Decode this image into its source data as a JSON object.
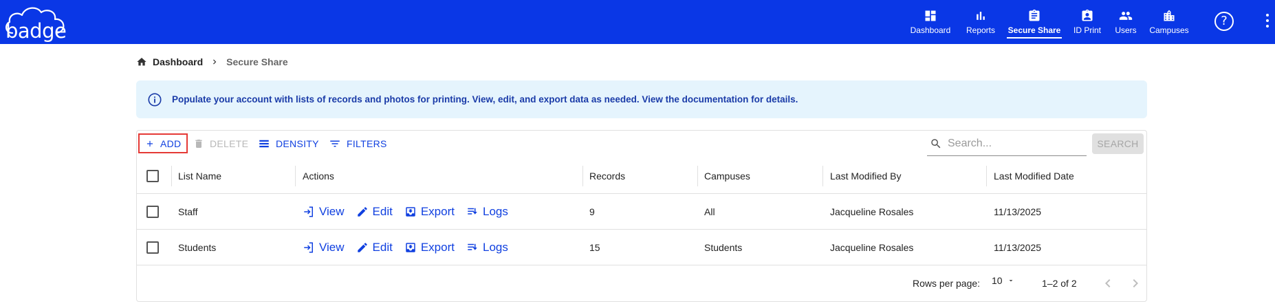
{
  "app": {
    "logo_text": "badge"
  },
  "nav": {
    "items": [
      {
        "label": "Dashboard",
        "icon": "dashboard-icon",
        "active": false
      },
      {
        "label": "Reports",
        "icon": "bar-chart-icon",
        "active": false
      },
      {
        "label": "Secure Share",
        "icon": "clipboard-icon",
        "active": true
      },
      {
        "label": "ID Print",
        "icon": "id-badge-icon",
        "active": false
      },
      {
        "label": "Users",
        "icon": "users-icon",
        "active": false
      },
      {
        "label": "Campuses",
        "icon": "buildings-icon",
        "active": false
      }
    ],
    "help_symbol": "?"
  },
  "breadcrumb": {
    "home_label": "Dashboard",
    "current": "Secure Share"
  },
  "info_banner": {
    "text": "Populate your account with lists of records and photos for printing. View, edit, and export data as needed. View the documentation for details."
  },
  "toolbar": {
    "add_label": "ADD",
    "delete_label": "DELETE",
    "density_label": "DENSITY",
    "filters_label": "FILTERS",
    "search_placeholder": "Search...",
    "search_button": "SEARCH"
  },
  "table": {
    "columns": [
      "List Name",
      "Actions",
      "Records",
      "Campuses",
      "Last Modified By",
      "Last Modified Date"
    ],
    "action_labels": {
      "view": "View",
      "edit": "Edit",
      "export": "Export",
      "logs": "Logs"
    },
    "rows": [
      {
        "name": "Staff",
        "records": "9",
        "campuses": "All",
        "modified_by": "Jacqueline Rosales",
        "modified_date": "11/13/2025"
      },
      {
        "name": "Students",
        "records": "15",
        "campuses": "Students",
        "modified_by": "Jacqueline Rosales",
        "modified_date": "11/13/2025"
      }
    ]
  },
  "pagination": {
    "rows_per_page_label": "Rows per page:",
    "rows_per_page": "10",
    "range": "1–2 of 2"
  },
  "colors": {
    "brand": "#0a37e6",
    "link": "#1040e0",
    "info_bg": "#e5f4fd",
    "info_text": "#1a3ba8",
    "highlight": "#e53935"
  }
}
